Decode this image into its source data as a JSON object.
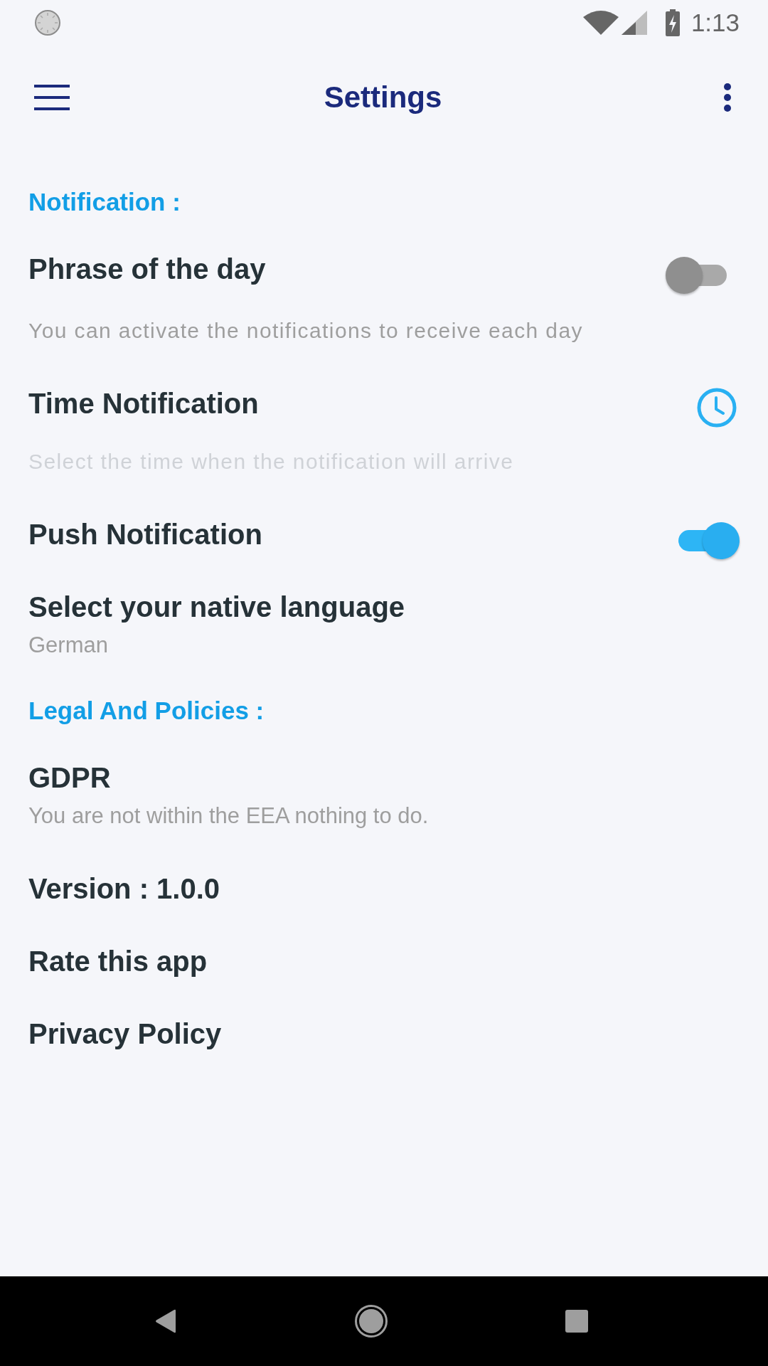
{
  "status_bar": {
    "time": "1:13"
  },
  "app_bar": {
    "title": "Settings"
  },
  "sections": [
    {
      "heading": "Notification :",
      "items": [
        {
          "kind": "switch",
          "title": "Phrase of the day",
          "on": false,
          "disabled": false,
          "description": "You can activate the notifications to receive each day"
        },
        {
          "kind": "time",
          "title": "Time Notification",
          "disabled": true,
          "description": "Select the time when the notification will arrive"
        },
        {
          "kind": "switch",
          "title": "Push Notification",
          "on": true,
          "disabled": false
        },
        {
          "kind": "value",
          "title": "Select your native language",
          "disabled": false,
          "value": "German"
        }
      ]
    },
    {
      "heading": "Legal And Policies :",
      "items": [
        {
          "kind": "text",
          "title": "GDPR",
          "description": "You are not within the EEA nothing to do."
        },
        {
          "kind": "text",
          "title": "Version : 1.0.0"
        },
        {
          "kind": "link",
          "title": "Rate this app"
        },
        {
          "kind": "link",
          "title": "Privacy Policy"
        }
      ]
    }
  ]
}
